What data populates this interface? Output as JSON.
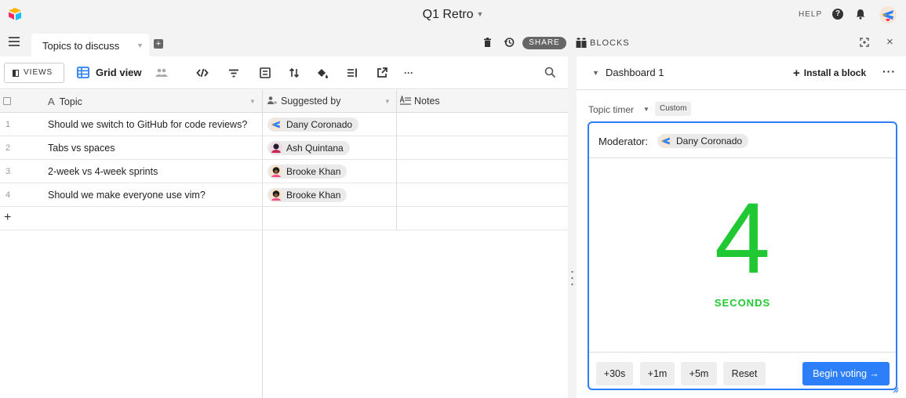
{
  "app": {
    "title": "Q1 Retro",
    "help_label": "HELP",
    "help_glyph": "?"
  },
  "tabs": {
    "active_label": "Topics to discuss",
    "add_glyph": "+"
  },
  "toolbar": {
    "share_label": "SHARE",
    "blocks_label": "BLOCKS",
    "close_glyph": "×"
  },
  "viewbar": {
    "views_label": "VIEWS",
    "view_name": "Grid view",
    "more_glyph": "···"
  },
  "grid": {
    "columns": [
      {
        "label": "Topic",
        "icon": "text-field-icon"
      },
      {
        "label": "Suggested by",
        "icon": "collaborator-field-icon"
      },
      {
        "label": "Notes",
        "icon": "long-text-field-icon"
      }
    ],
    "rows": [
      {
        "num": "1",
        "topic": "Should we switch to GitHub for code reviews?",
        "suggested_by": "Dany Coronado",
        "notes": ""
      },
      {
        "num": "2",
        "topic": "Tabs vs spaces",
        "suggested_by": "Ash Quintana",
        "notes": ""
      },
      {
        "num": "3",
        "topic": "2-week vs 4-week sprints",
        "suggested_by": "Brooke Khan",
        "notes": ""
      },
      {
        "num": "4",
        "topic": "Should we make everyone use vim?",
        "suggested_by": "Brooke Khan",
        "notes": ""
      }
    ],
    "add_row_glyph": "+"
  },
  "dashboard": {
    "title": "Dashboard 1",
    "install_label": "Install a block",
    "more_glyph": "···"
  },
  "timer": {
    "block_name": "Topic timer",
    "block_tag": "Custom",
    "moderator_label": "Moderator:",
    "moderator_name": "Dany Coronado",
    "remaining": "4",
    "unit_label": "SECONDS",
    "buttons": [
      "+30s",
      "+1m",
      "+5m",
      "Reset"
    ],
    "primary_label": "Begin voting →"
  },
  "colors": {
    "accent_blue": "#2d7ff9",
    "timer_green": "#20c933",
    "share_bg": "#666666"
  }
}
